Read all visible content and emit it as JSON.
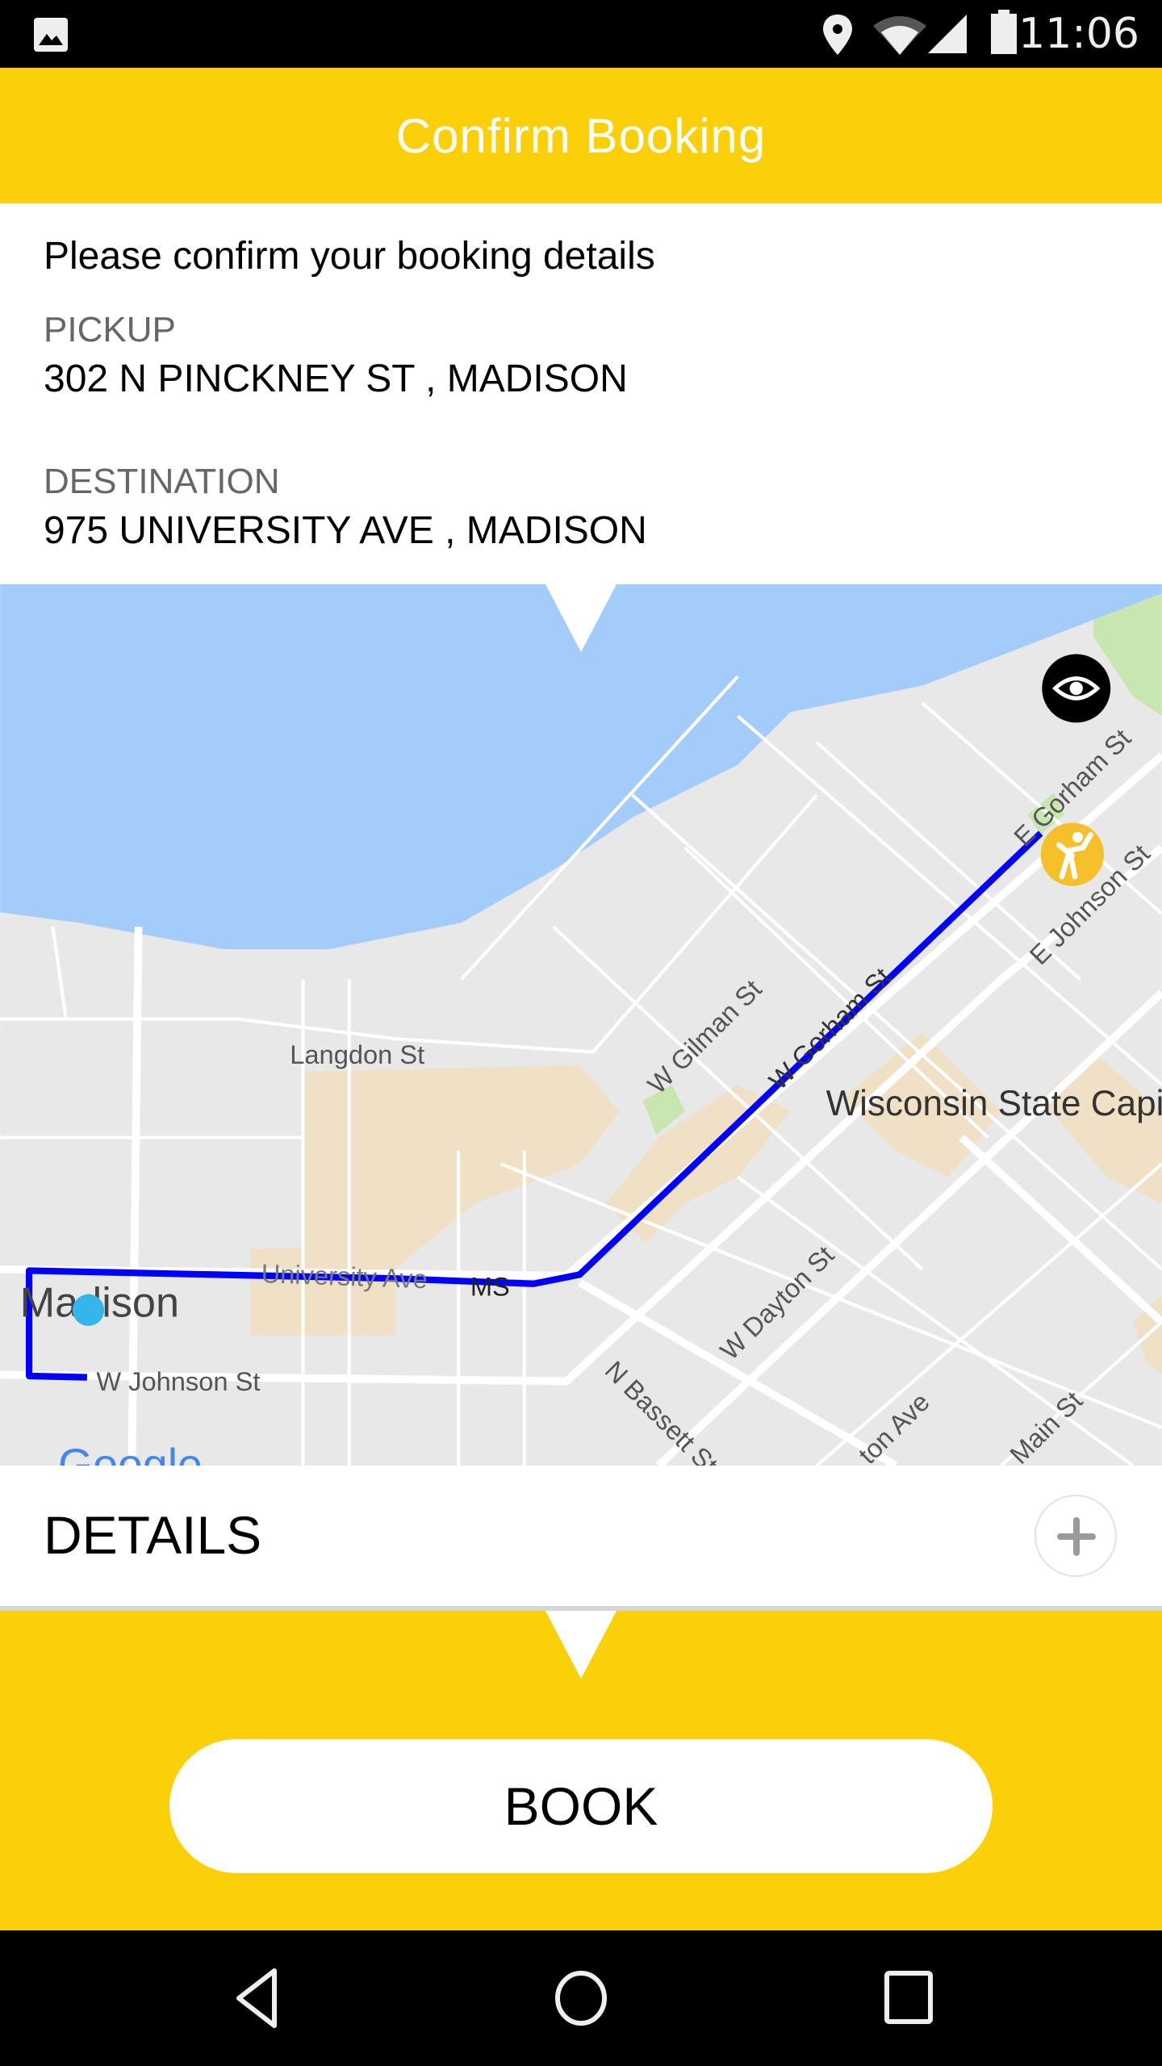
{
  "status_bar": {
    "time": "11:06",
    "icons": [
      "image-icon",
      "location-icon",
      "wifi-icon",
      "signal-icon",
      "battery-icon"
    ]
  },
  "app_bar": {
    "title": "Confirm Booking"
  },
  "booking": {
    "prompt": "Please confirm your booking details",
    "pickup_label": "PICKUP",
    "pickup_address": "302 N PINCKNEY ST , MADISON",
    "destination_label": "DESTINATION",
    "destination_address": "975 UNIVERSITY AVE , MADISON"
  },
  "map": {
    "labels": {
      "langdon": "Langdon St",
      "w_gilman": "W Gilman St",
      "w_gorham": "W Gorham St",
      "e_gorham": "E Gorham St",
      "e_johnson": "E Johnson St",
      "capitol": "Wisconsin State Capi",
      "university": "University Ave",
      "ms": "MS",
      "madison": "Madison",
      "w_johnson": "W Johnson St",
      "w_dayton": "W Dayton St",
      "n_bassett": "N Bassett St",
      "ave": "ton Ave",
      "main": "Main St",
      "google": "Google"
    },
    "route_color": "#0000FF",
    "water_color": "#A3CCFA",
    "icons": [
      "eye-icon",
      "pickup-person-icon",
      "current-location-dot"
    ]
  },
  "details": {
    "title": "DETAILS",
    "expand_icon": "plus-icon"
  },
  "actions": {
    "book_label": "BOOK"
  },
  "colors": {
    "brand_yellow": "#FBD00B"
  },
  "nav_bar": {
    "icons": [
      "back-icon",
      "home-icon",
      "recents-icon"
    ]
  }
}
